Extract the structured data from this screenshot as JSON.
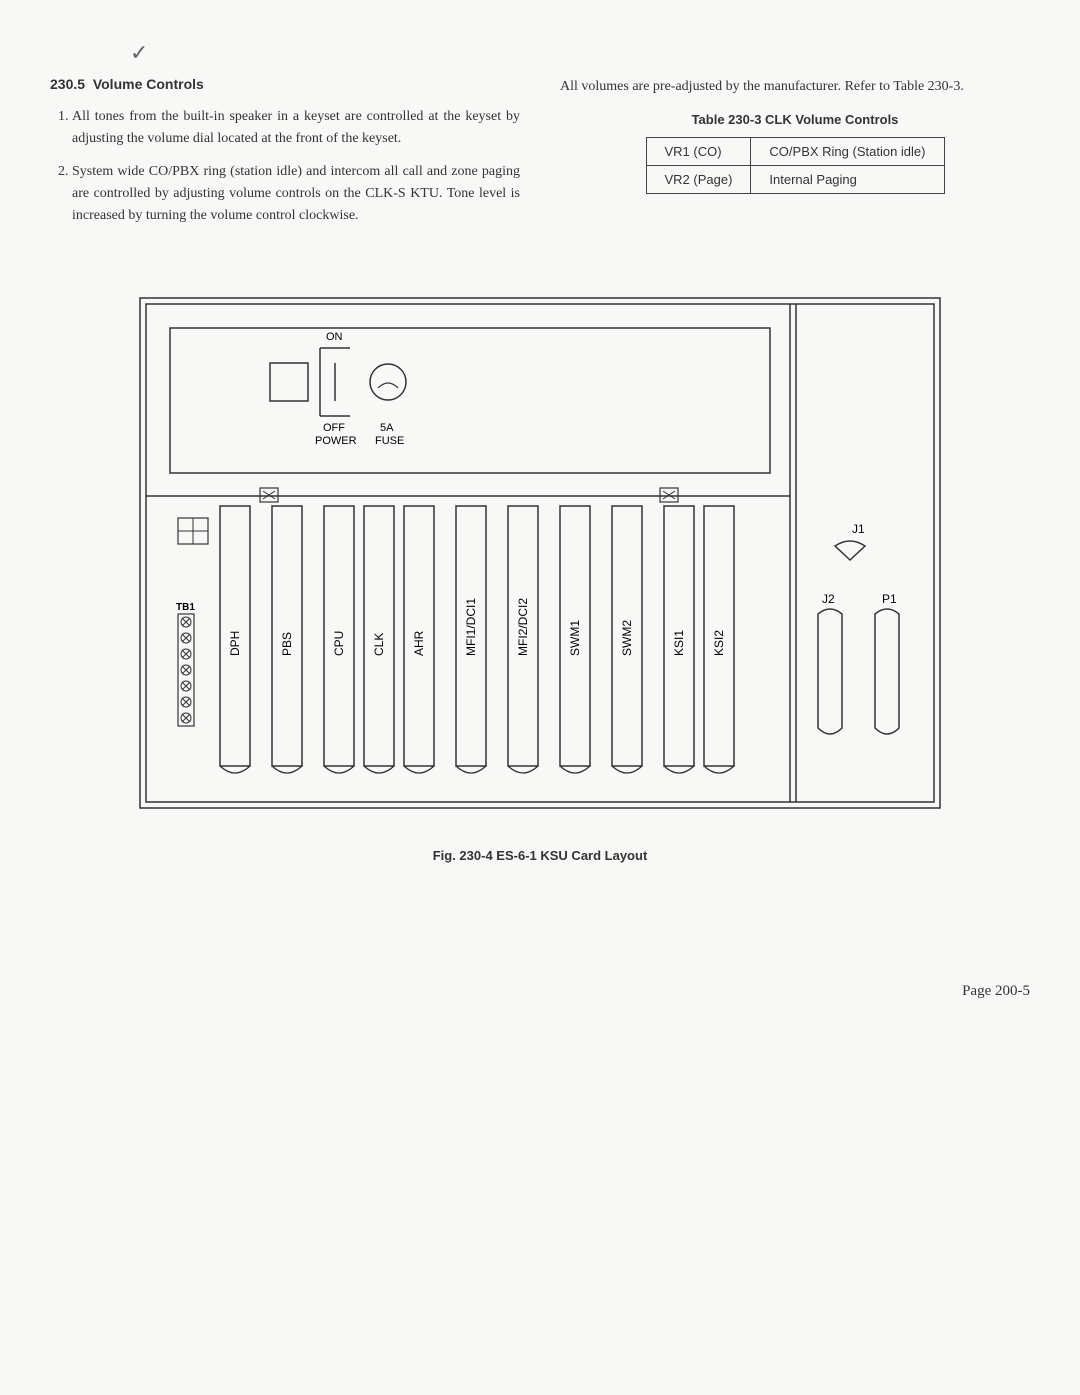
{
  "section": {
    "number": "230.5",
    "title": "Volume Controls"
  },
  "list": [
    "All tones from the built-in speaker in a keyset are controlled at the keyset by adjusting the volume dial located at the front of the keyset.",
    "System wide CO/PBX ring (station idle) and intercom all call and zone paging are controlled by adjusting volume controls on the CLK-S KTU. Tone level is increased by turning the volume control clockwise."
  ],
  "right_paragraph": "All volumes are pre-adjusted by the manufacturer. Refer to Table 230-3.",
  "table": {
    "title": "Table 230-3  CLK Volume Controls",
    "rows": [
      [
        "VR1 (CO)",
        "CO/PBX Ring (Station idle)"
      ],
      [
        "VR2 (Page)",
        "Internal Paging"
      ]
    ]
  },
  "diagram": {
    "labels": {
      "on": "ON",
      "off": "OFF",
      "power": "POWER",
      "fuse_amp": "5A",
      "fuse": "FUSE",
      "tb1": "TB1",
      "j1": "J1",
      "j2": "J2",
      "p1": "P1"
    },
    "slots": [
      "DPH",
      "PBS",
      "CPU",
      "CLK",
      "AHR",
      "MFI1/DCI1",
      "MFI2/DCI2",
      "SWM1",
      "SWM2",
      "KSI1",
      "KSI2"
    ]
  },
  "figure_caption": "Fig. 230-4   ES-6-1 KSU Card Layout",
  "page_number": "Page 200-5"
}
